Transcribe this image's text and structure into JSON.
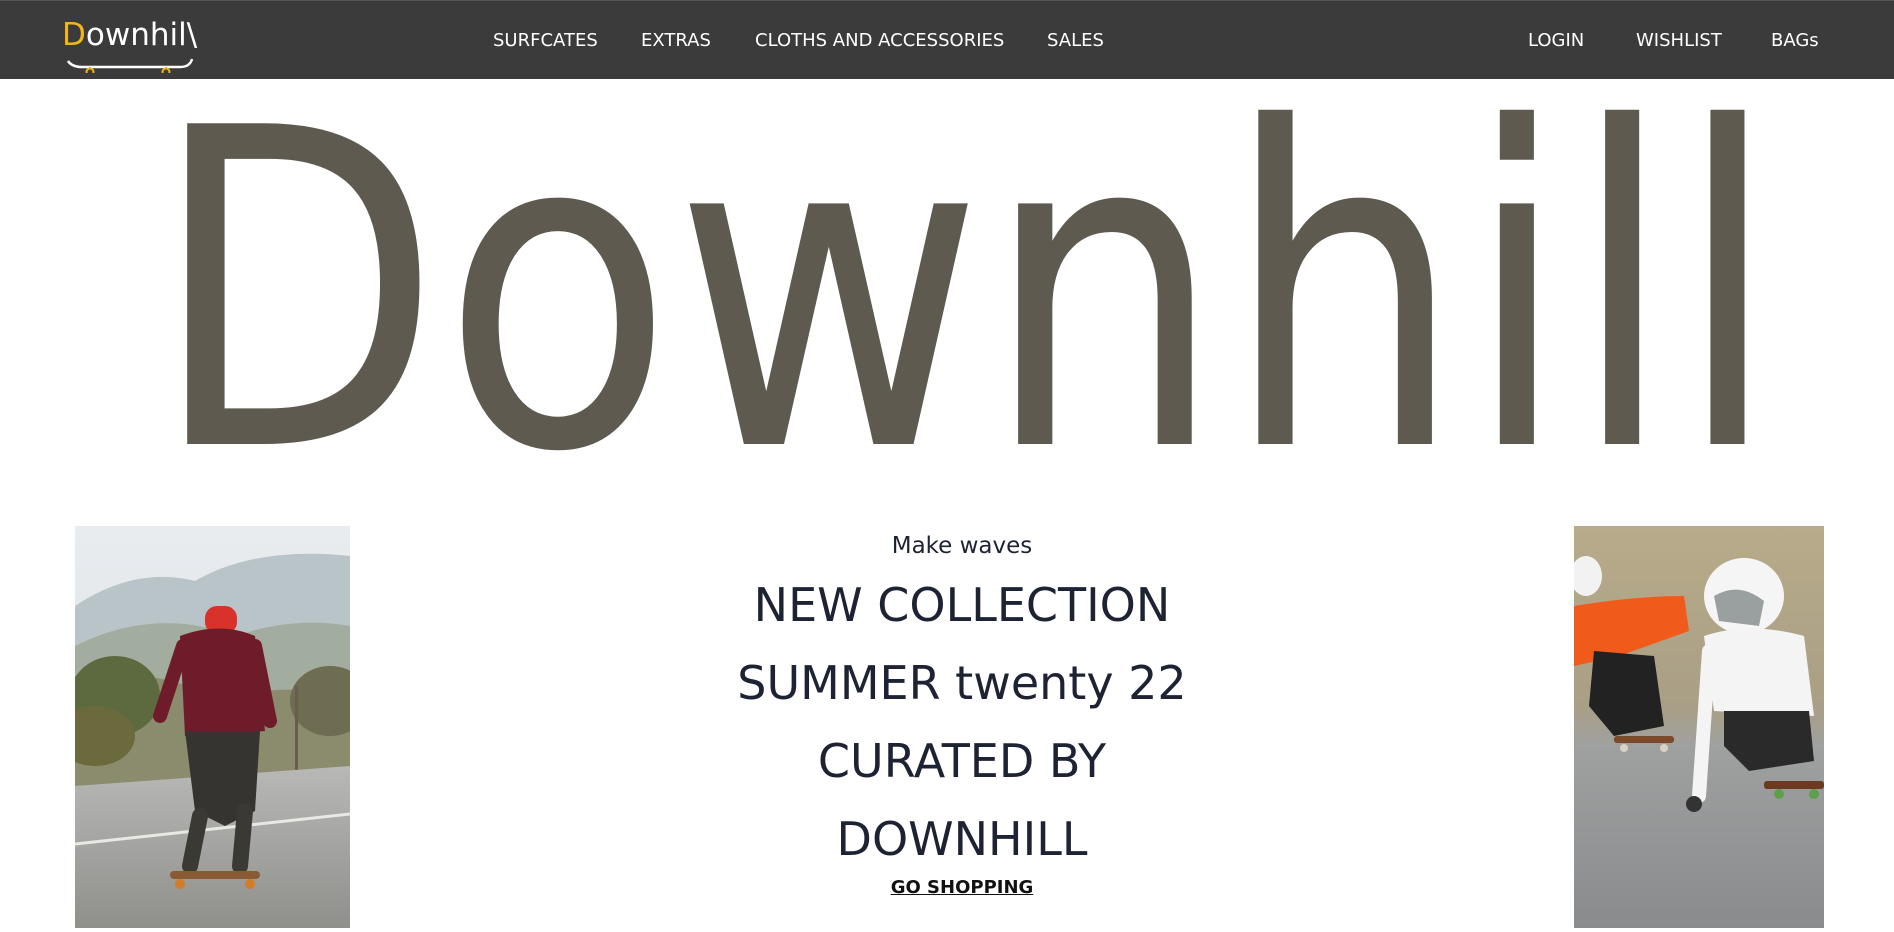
{
  "brand": {
    "logo_first_letter": "D",
    "logo_rest": "ownhil",
    "logo_slash": "\\",
    "accent_color": "#f3b51c",
    "navbar_color": "#3b3b3b"
  },
  "nav": {
    "main_links": [
      "SURFCATES",
      "EXTRAS",
      "CLOTHS AND ACCESSORIES",
      "SALES"
    ],
    "right_links": [
      "LOGIN",
      "WISHLIST",
      "BAGs"
    ]
  },
  "hero": {
    "title": "Downhill",
    "title_color": "#5e5a50"
  },
  "promo": {
    "tagline": "Make waves",
    "headline_lines": [
      "NEW COLLECTION",
      "SUMMER twenty 22",
      "CURATED BY",
      "DOWNHILL"
    ],
    "cta_label": "GO SHOPPING",
    "text_color": "#1e2333"
  },
  "photos": {
    "left": "skateboarder-rolling-down-mountain-road",
    "right": "downhill-longboard-racers-in-helmets"
  }
}
